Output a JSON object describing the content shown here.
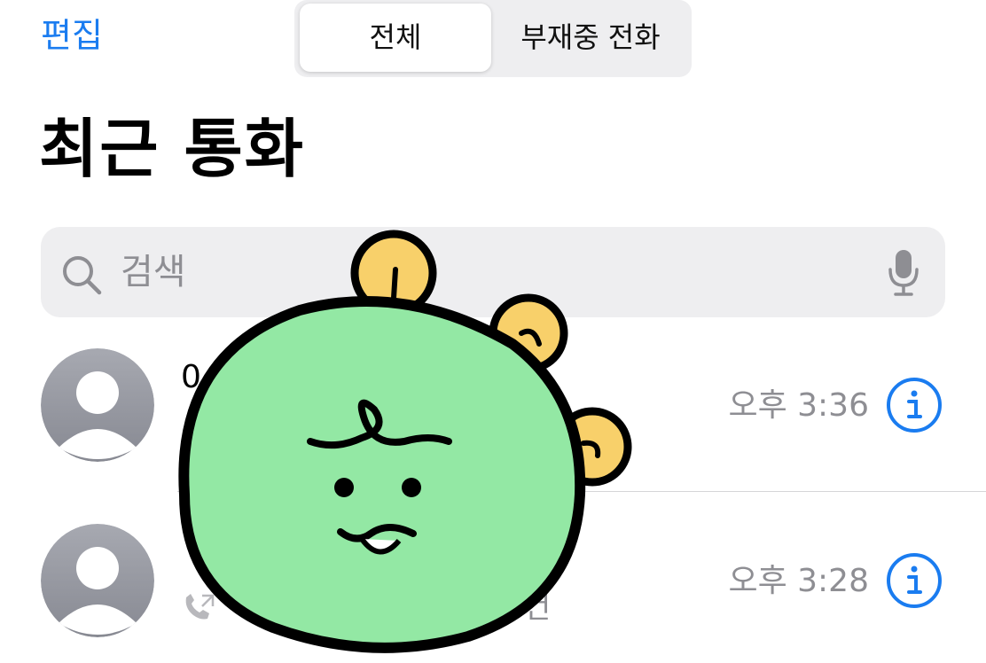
{
  "header": {
    "edit_label": "편집",
    "tabs": [
      {
        "label": "전체",
        "active": true
      },
      {
        "label": "부재중 전화",
        "active": false
      }
    ]
  },
  "page_title": "최근 통화",
  "search": {
    "placeholder": "검색",
    "icon": "search-icon",
    "mic_icon": "microphone-icon"
  },
  "calls": [
    {
      "caller": "0",
      "time": "오후 3:36"
    },
    {
      "caller": "",
      "sub_suffix": "건",
      "time": "오후 3:28"
    }
  ],
  "colors": {
    "accent": "#1a7cf0",
    "secondary_text": "#8e8e93",
    "sticker_green": "#93e8a4",
    "sticker_yellow": "#f8d06a"
  }
}
